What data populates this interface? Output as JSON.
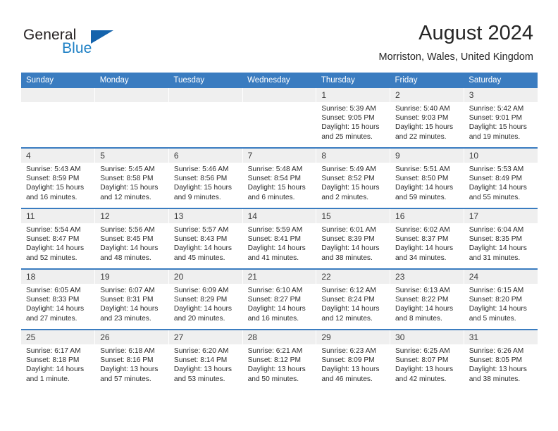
{
  "brand": {
    "name_part1": "General",
    "name_part2": "Blue",
    "flag_icon": "triangle-flag-icon",
    "accent_color": "#1463ac",
    "blue_text_color": "#1c7fc4"
  },
  "header": {
    "month_title": "August 2024",
    "location": "Morriston, Wales, United Kingdom"
  },
  "calendar": {
    "header_bg": "#3a7cc0",
    "daynum_bg": "#efefef",
    "weekday_headers": [
      "Sunday",
      "Monday",
      "Tuesday",
      "Wednesday",
      "Thursday",
      "Friday",
      "Saturday"
    ],
    "weeks": [
      [
        {
          "day": "",
          "empty": true,
          "sunrise": "",
          "sunset": "",
          "daylight1": "",
          "daylight2": ""
        },
        {
          "day": "",
          "empty": true,
          "sunrise": "",
          "sunset": "",
          "daylight1": "",
          "daylight2": ""
        },
        {
          "day": "",
          "empty": true,
          "sunrise": "",
          "sunset": "",
          "daylight1": "",
          "daylight2": ""
        },
        {
          "day": "",
          "empty": true,
          "sunrise": "",
          "sunset": "",
          "daylight1": "",
          "daylight2": ""
        },
        {
          "day": "1",
          "empty": false,
          "sunrise": "Sunrise: 5:39 AM",
          "sunset": "Sunset: 9:05 PM",
          "daylight1": "Daylight: 15 hours",
          "daylight2": "and 25 minutes."
        },
        {
          "day": "2",
          "empty": false,
          "sunrise": "Sunrise: 5:40 AM",
          "sunset": "Sunset: 9:03 PM",
          "daylight1": "Daylight: 15 hours",
          "daylight2": "and 22 minutes."
        },
        {
          "day": "3",
          "empty": false,
          "sunrise": "Sunrise: 5:42 AM",
          "sunset": "Sunset: 9:01 PM",
          "daylight1": "Daylight: 15 hours",
          "daylight2": "and 19 minutes."
        }
      ],
      [
        {
          "day": "4",
          "empty": false,
          "sunrise": "Sunrise: 5:43 AM",
          "sunset": "Sunset: 8:59 PM",
          "daylight1": "Daylight: 15 hours",
          "daylight2": "and 16 minutes."
        },
        {
          "day": "5",
          "empty": false,
          "sunrise": "Sunrise: 5:45 AM",
          "sunset": "Sunset: 8:58 PM",
          "daylight1": "Daylight: 15 hours",
          "daylight2": "and 12 minutes."
        },
        {
          "day": "6",
          "empty": false,
          "sunrise": "Sunrise: 5:46 AM",
          "sunset": "Sunset: 8:56 PM",
          "daylight1": "Daylight: 15 hours",
          "daylight2": "and 9 minutes."
        },
        {
          "day": "7",
          "empty": false,
          "sunrise": "Sunrise: 5:48 AM",
          "sunset": "Sunset: 8:54 PM",
          "daylight1": "Daylight: 15 hours",
          "daylight2": "and 6 minutes."
        },
        {
          "day": "8",
          "empty": false,
          "sunrise": "Sunrise: 5:49 AM",
          "sunset": "Sunset: 8:52 PM",
          "daylight1": "Daylight: 15 hours",
          "daylight2": "and 2 minutes."
        },
        {
          "day": "9",
          "empty": false,
          "sunrise": "Sunrise: 5:51 AM",
          "sunset": "Sunset: 8:50 PM",
          "daylight1": "Daylight: 14 hours",
          "daylight2": "and 59 minutes."
        },
        {
          "day": "10",
          "empty": false,
          "sunrise": "Sunrise: 5:53 AM",
          "sunset": "Sunset: 8:49 PM",
          "daylight1": "Daylight: 14 hours",
          "daylight2": "and 55 minutes."
        }
      ],
      [
        {
          "day": "11",
          "empty": false,
          "sunrise": "Sunrise: 5:54 AM",
          "sunset": "Sunset: 8:47 PM",
          "daylight1": "Daylight: 14 hours",
          "daylight2": "and 52 minutes."
        },
        {
          "day": "12",
          "empty": false,
          "sunrise": "Sunrise: 5:56 AM",
          "sunset": "Sunset: 8:45 PM",
          "daylight1": "Daylight: 14 hours",
          "daylight2": "and 48 minutes."
        },
        {
          "day": "13",
          "empty": false,
          "sunrise": "Sunrise: 5:57 AM",
          "sunset": "Sunset: 8:43 PM",
          "daylight1": "Daylight: 14 hours",
          "daylight2": "and 45 minutes."
        },
        {
          "day": "14",
          "empty": false,
          "sunrise": "Sunrise: 5:59 AM",
          "sunset": "Sunset: 8:41 PM",
          "daylight1": "Daylight: 14 hours",
          "daylight2": "and 41 minutes."
        },
        {
          "day": "15",
          "empty": false,
          "sunrise": "Sunrise: 6:01 AM",
          "sunset": "Sunset: 8:39 PM",
          "daylight1": "Daylight: 14 hours",
          "daylight2": "and 38 minutes."
        },
        {
          "day": "16",
          "empty": false,
          "sunrise": "Sunrise: 6:02 AM",
          "sunset": "Sunset: 8:37 PM",
          "daylight1": "Daylight: 14 hours",
          "daylight2": "and 34 minutes."
        },
        {
          "day": "17",
          "empty": false,
          "sunrise": "Sunrise: 6:04 AM",
          "sunset": "Sunset: 8:35 PM",
          "daylight1": "Daylight: 14 hours",
          "daylight2": "and 31 minutes."
        }
      ],
      [
        {
          "day": "18",
          "empty": false,
          "sunrise": "Sunrise: 6:05 AM",
          "sunset": "Sunset: 8:33 PM",
          "daylight1": "Daylight: 14 hours",
          "daylight2": "and 27 minutes."
        },
        {
          "day": "19",
          "empty": false,
          "sunrise": "Sunrise: 6:07 AM",
          "sunset": "Sunset: 8:31 PM",
          "daylight1": "Daylight: 14 hours",
          "daylight2": "and 23 minutes."
        },
        {
          "day": "20",
          "empty": false,
          "sunrise": "Sunrise: 6:09 AM",
          "sunset": "Sunset: 8:29 PM",
          "daylight1": "Daylight: 14 hours",
          "daylight2": "and 20 minutes."
        },
        {
          "day": "21",
          "empty": false,
          "sunrise": "Sunrise: 6:10 AM",
          "sunset": "Sunset: 8:27 PM",
          "daylight1": "Daylight: 14 hours",
          "daylight2": "and 16 minutes."
        },
        {
          "day": "22",
          "empty": false,
          "sunrise": "Sunrise: 6:12 AM",
          "sunset": "Sunset: 8:24 PM",
          "daylight1": "Daylight: 14 hours",
          "daylight2": "and 12 minutes."
        },
        {
          "day": "23",
          "empty": false,
          "sunrise": "Sunrise: 6:13 AM",
          "sunset": "Sunset: 8:22 PM",
          "daylight1": "Daylight: 14 hours",
          "daylight2": "and 8 minutes."
        },
        {
          "day": "24",
          "empty": false,
          "sunrise": "Sunrise: 6:15 AM",
          "sunset": "Sunset: 8:20 PM",
          "daylight1": "Daylight: 14 hours",
          "daylight2": "and 5 minutes."
        }
      ],
      [
        {
          "day": "25",
          "empty": false,
          "sunrise": "Sunrise: 6:17 AM",
          "sunset": "Sunset: 8:18 PM",
          "daylight1": "Daylight: 14 hours",
          "daylight2": "and 1 minute."
        },
        {
          "day": "26",
          "empty": false,
          "sunrise": "Sunrise: 6:18 AM",
          "sunset": "Sunset: 8:16 PM",
          "daylight1": "Daylight: 13 hours",
          "daylight2": "and 57 minutes."
        },
        {
          "day": "27",
          "empty": false,
          "sunrise": "Sunrise: 6:20 AM",
          "sunset": "Sunset: 8:14 PM",
          "daylight1": "Daylight: 13 hours",
          "daylight2": "and 53 minutes."
        },
        {
          "day": "28",
          "empty": false,
          "sunrise": "Sunrise: 6:21 AM",
          "sunset": "Sunset: 8:12 PM",
          "daylight1": "Daylight: 13 hours",
          "daylight2": "and 50 minutes."
        },
        {
          "day": "29",
          "empty": false,
          "sunrise": "Sunrise: 6:23 AM",
          "sunset": "Sunset: 8:09 PM",
          "daylight1": "Daylight: 13 hours",
          "daylight2": "and 46 minutes."
        },
        {
          "day": "30",
          "empty": false,
          "sunrise": "Sunrise: 6:25 AM",
          "sunset": "Sunset: 8:07 PM",
          "daylight1": "Daylight: 13 hours",
          "daylight2": "and 42 minutes."
        },
        {
          "day": "31",
          "empty": false,
          "sunrise": "Sunrise: 6:26 AM",
          "sunset": "Sunset: 8:05 PM",
          "daylight1": "Daylight: 13 hours",
          "daylight2": "and 38 minutes."
        }
      ]
    ]
  }
}
